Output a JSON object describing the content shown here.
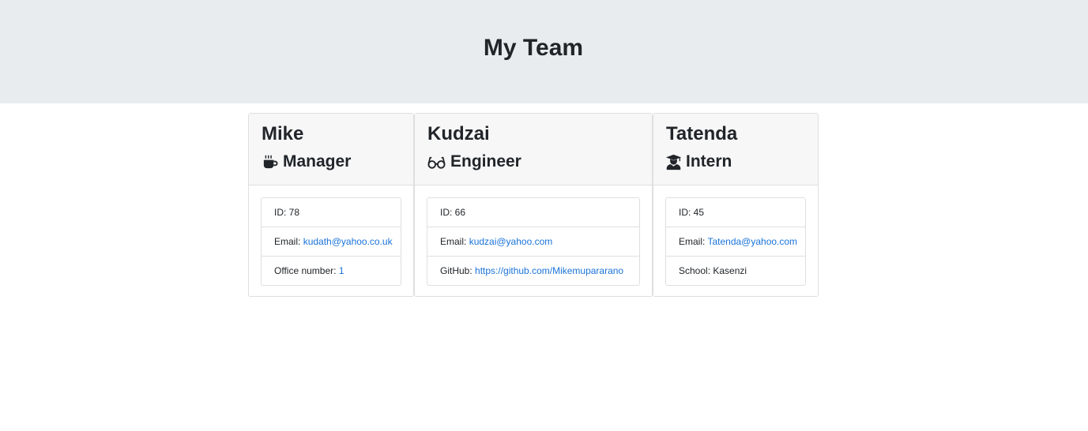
{
  "header": {
    "title": "My Team"
  },
  "cards": [
    {
      "name": "Mike",
      "role": "Manager",
      "role_icon": "coffee-icon",
      "id_label": "ID: ",
      "id": "78",
      "email_label": "Email: ",
      "email": "kudath@yahoo.co.uk",
      "extra_label": "Office number: ",
      "extra_value": "1"
    },
    {
      "name": "Kudzai",
      "role": "Engineer",
      "role_icon": "glasses-icon",
      "id_label": "ID: ",
      "id": "66",
      "email_label": "Email: ",
      "email": "kudzai@yahoo.com",
      "extra_label": "GitHub: ",
      "extra_value": "https://github.com/Mikemupararano"
    },
    {
      "name": "Tatenda",
      "role": "Intern",
      "role_icon": "graduate-icon",
      "id_label": "ID: ",
      "id": "45",
      "email_label": "Email: ",
      "email": "Tatenda@yahoo.com",
      "extra_label": "School: ",
      "extra_value": "Kasenzi"
    }
  ],
  "colors": {
    "header_bg": "#e9ecef",
    "card_header_bg": "#f7f7f7",
    "link": "#1a73d9",
    "border": "#dfdfdf"
  }
}
